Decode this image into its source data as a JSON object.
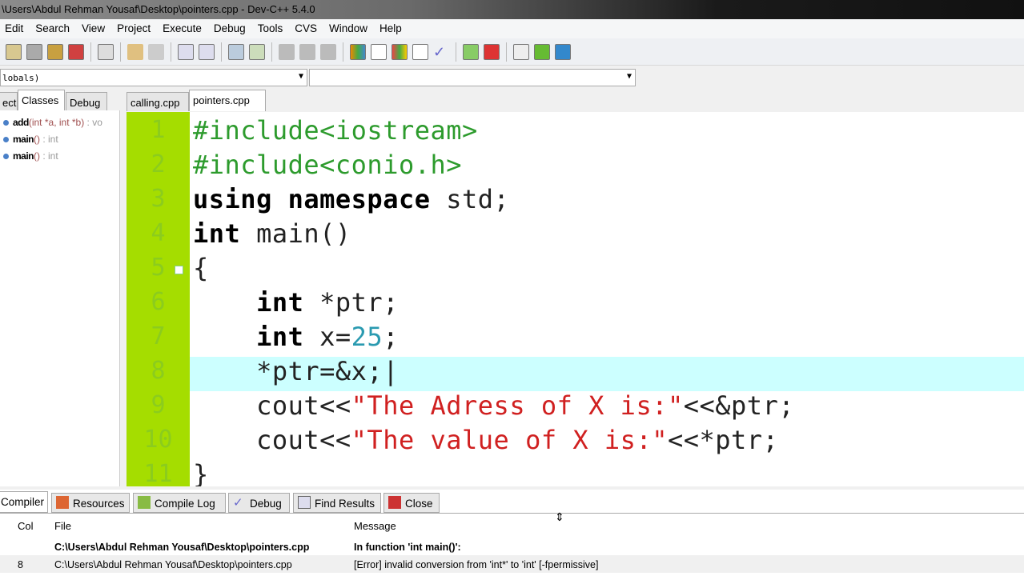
{
  "window": {
    "title": "\\Users\\Abdul Rehman Yousaf\\Desktop\\pointers.cpp - Dev-C++ 5.4.0"
  },
  "menu": [
    "Edit",
    "Search",
    "View",
    "Project",
    "Execute",
    "Debug",
    "Tools",
    "CVS",
    "Window",
    "Help"
  ],
  "scope_dropdown": {
    "value": "lobals)"
  },
  "member_dropdown": {
    "value": ""
  },
  "left_tabs": [
    "ect",
    "Classes",
    "Debug"
  ],
  "file_tabs": [
    "calling.cpp",
    "pointers.cpp"
  ],
  "classes": [
    {
      "name": "add",
      "sig": "(int *a, int *b)",
      "ret": " : vo"
    },
    {
      "name": "main",
      "sig": "()",
      "ret": " : int"
    },
    {
      "name": "main",
      "sig": "()",
      "ret": " : int"
    }
  ],
  "code": {
    "line_numbers": [
      "1",
      "2",
      "3",
      "4",
      "5",
      "6",
      "7",
      "8",
      "9",
      "10",
      "11"
    ]
  },
  "bottom_tabs": [
    "Compiler",
    "Resources",
    "Compile Log",
    "Debug",
    "Find Results",
    "Close"
  ],
  "messages": {
    "headers": {
      "col": "Col",
      "file": "File",
      "message": "Message"
    },
    "rows": [
      {
        "col": "",
        "file": "C:\\Users\\Abdul Rehman Yousaf\\Desktop\\pointers.cpp",
        "message": "In function 'int main()':"
      },
      {
        "col": "8",
        "file": "C:\\Users\\Abdul Rehman Yousaf\\Desktop\\pointers.cpp",
        "message": "[Error] invalid conversion from 'int*' to 'int' [-fpermissive]"
      }
    ]
  }
}
